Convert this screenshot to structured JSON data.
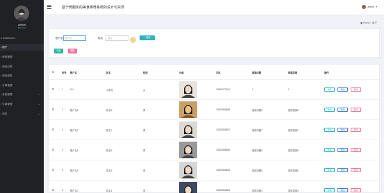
{
  "sidebar": {
    "user_name": "admin",
    "user_status": "Online",
    "items": [
      {
        "label": "e Dashboard",
        "active": false,
        "has_chevron": false
      },
      {
        "label": "• 用户",
        "active": true,
        "has_chevron": false
      },
      {
        "label": "• 商家管理",
        "active": false,
        "has_chevron": false
      },
      {
        "label": "• 商品分类",
        "active": false,
        "has_chevron": false
      },
      {
        "label": "• 商品信息",
        "active": false,
        "has_chevron": false
      },
      {
        "label": "• 订单管理",
        "active": false,
        "has_chevron": false
      },
      {
        "label": "• 系统管理",
        "active": false,
        "has_chevron": true
      },
      {
        "label": "• 订单管理",
        "active": false,
        "has_chevron": true
      },
      {
        "label": "• 资讯",
        "active": false,
        "has_chevron": true
      }
    ]
  },
  "topbar": {
    "title": "基于微服务的美食推荐系统的设计与实现",
    "user_label": "admin"
  },
  "breadcrumb": {
    "home": "Home",
    "separator": "•",
    "current": "用户"
  },
  "search": {
    "account_label": "账户名",
    "account_placeholder": "账户名",
    "name_label": "姓名",
    "name_placeholder": "姓名",
    "search_button": "搜索",
    "add_button": "添加",
    "delete_button": "删除"
  },
  "table": {
    "headers": [
      "序号",
      "账户名",
      "姓名",
      "性别",
      "头像",
      "手机",
      "邮箱问题",
      "邮箱答案",
      "操作"
    ],
    "rows": [
      {
        "index": "1",
        "account": "111",
        "name": "小彩吃",
        "gender": "女",
        "phone": "13564572321",
        "question": "1",
        "answer": "1",
        "photo": "girl1"
      },
      {
        "index": "2",
        "account": "账户名8",
        "name": "姓名8",
        "gender": "男",
        "phone": "13823888888",
        "question": "密保问题8",
        "answer": "密保答案8",
        "photo": "food"
      },
      {
        "index": "3",
        "account": "账户名7",
        "name": "姓名7",
        "gender": "男",
        "phone": "13823888887",
        "question": "密保问题7",
        "answer": "密保答案7",
        "photo": "girl2"
      },
      {
        "index": "4",
        "account": "账户名6",
        "name": "姓名6",
        "gender": "男",
        "phone": "13823888886",
        "question": "密保问题6",
        "answer": "密保答案6",
        "photo": "man1"
      },
      {
        "index": "5",
        "account": "账户名5",
        "name": "姓名5",
        "gender": "男",
        "phone": "13823888885",
        "question": "密保问题5",
        "answer": "密保答案5",
        "photo": "man2"
      },
      {
        "index": "6",
        "account": "账户名4",
        "name": "姓名4",
        "gender": "男",
        "phone": "13823888884",
        "question": "密保问题4",
        "answer": "密保答案4",
        "photo": "man3"
      }
    ],
    "actions": {
      "detail": "详情",
      "edit": "修改",
      "delete": "删除"
    }
  },
  "colors": {
    "sidebar_bg": "#1f2125",
    "search_btn": "#2bb3c0",
    "add_btn": "#27b79a",
    "delete_btn": "#f0729e",
    "edit_btn": "#3a7bd5"
  }
}
